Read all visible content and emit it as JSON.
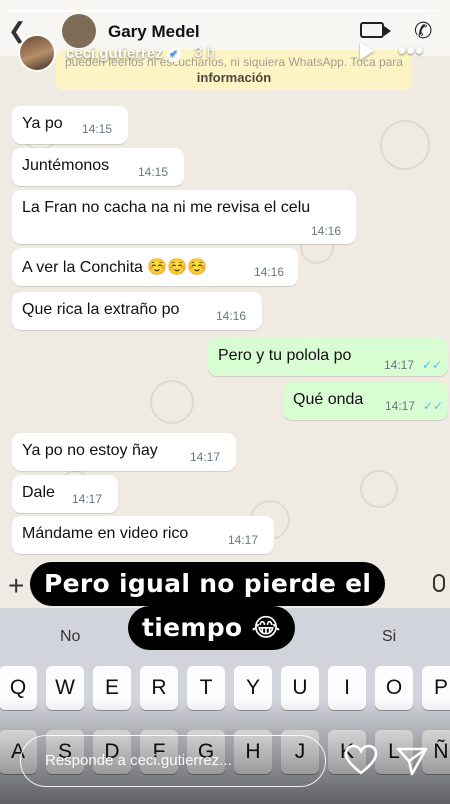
{
  "story": {
    "username": "ceci.gutierrez",
    "time_ago": "3 h",
    "progress_fraction": 0.95,
    "reply_placeholder": "Responde a ceci.gutierrez..."
  },
  "chat": {
    "contact_name": "Gary Medel",
    "banner_line1": "pueden leerlos ni escucharlos, ni siquiera WhatsApp. Toca para",
    "banner_line2": "información"
  },
  "messages": [
    {
      "dir": "in",
      "text": "Ya po",
      "time": "14:15"
    },
    {
      "dir": "in",
      "text": "Juntémonos",
      "time": "14:15"
    },
    {
      "dir": "in",
      "text": "La Fran no cacha na ni me revisa el celu",
      "time": "14:16"
    },
    {
      "dir": "in",
      "text": "A ver la Conchita ☺️☺️☺️",
      "time": "14:16"
    },
    {
      "dir": "in",
      "text": "Que rica la extraño po",
      "time": "14:16"
    },
    {
      "dir": "out",
      "text": "Pero y tu polola po",
      "time": "14:17"
    },
    {
      "dir": "out",
      "text": "Qué onda",
      "time": "14:17"
    },
    {
      "dir": "in",
      "text": "Ya po no estoy ñay",
      "time": "14:17"
    },
    {
      "dir": "in",
      "text": "Dale",
      "time": "14:17"
    },
    {
      "dir": "in",
      "text": "Mándame en video rico",
      "time": "14:17"
    }
  ],
  "caption": {
    "line1": "Pero igual no pierde el",
    "line2": "tiempo 😂"
  },
  "keyboard": {
    "suggestions": [
      "No",
      "Si"
    ],
    "row1": [
      "Q",
      "W",
      "E",
      "R",
      "T",
      "Y",
      "U",
      "I",
      "O",
      "P"
    ],
    "row2": [
      "A",
      "S",
      "D",
      "F",
      "G",
      "H",
      "J",
      "K",
      "L",
      "Ñ"
    ]
  },
  "colors": {
    "incoming_bubble": "#ffffff",
    "outgoing_bubble": "#d9fdd3",
    "read_ticks": "#53bdeb",
    "caption_bg": "#000000",
    "verified_badge": "#3897f0"
  }
}
